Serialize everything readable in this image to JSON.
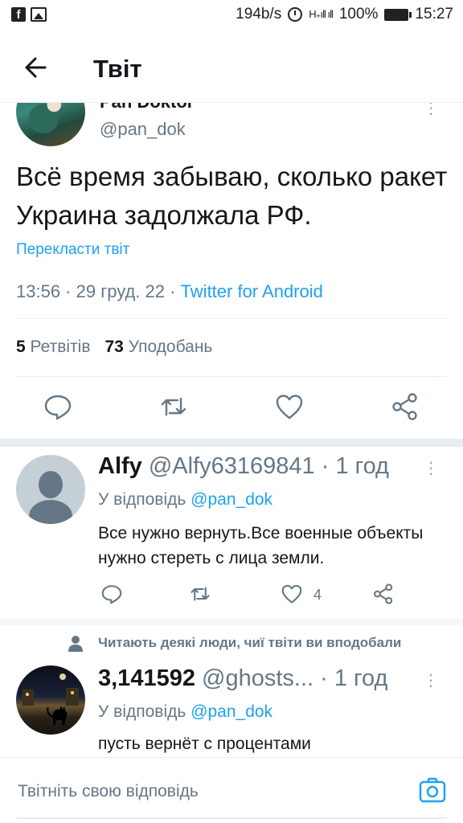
{
  "status_bar": {
    "speed": "194b/s",
    "battery": "100%",
    "time": "15:27"
  },
  "header": {
    "title": "Твіт"
  },
  "main_tweet": {
    "author_name_partial": "Pan Doktor",
    "handle": "@pan_dok",
    "text": "Всё время забываю, сколько ракет Украина задолжала РФ.",
    "translate_label": "Перекласти твіт",
    "timestamp": "13:56 · 29 груд. 22 · ",
    "source": "Twitter for Android",
    "retweets_count": "5",
    "retweets_label": "Ретвітів",
    "likes_count": "73",
    "likes_label": "Уподобань"
  },
  "replies": [
    {
      "name": "Alfy",
      "handle": "@Alfy63169841 · 1 год",
      "reply_prefix": "У відповідь ",
      "reply_to": "@pan_dok",
      "text": "Все нужно вернуть.Все военные объекты нужно стереть с лица земли.",
      "like_count": "4"
    },
    {
      "social_context": "Читають деякі люди, чиї твіти ви вподобали",
      "name": "3,141592",
      "handle": "@ghosts... · 1 год",
      "reply_prefix": "У відповідь ",
      "reply_to": "@pan_dok",
      "text": "пусть вернёт с процентами"
    }
  ],
  "compose": {
    "placeholder": "Твітніть свою відповідь"
  },
  "colors": {
    "accent": "#1da1f2",
    "secondary_text": "#657786",
    "divider": "#e6ecf0"
  }
}
